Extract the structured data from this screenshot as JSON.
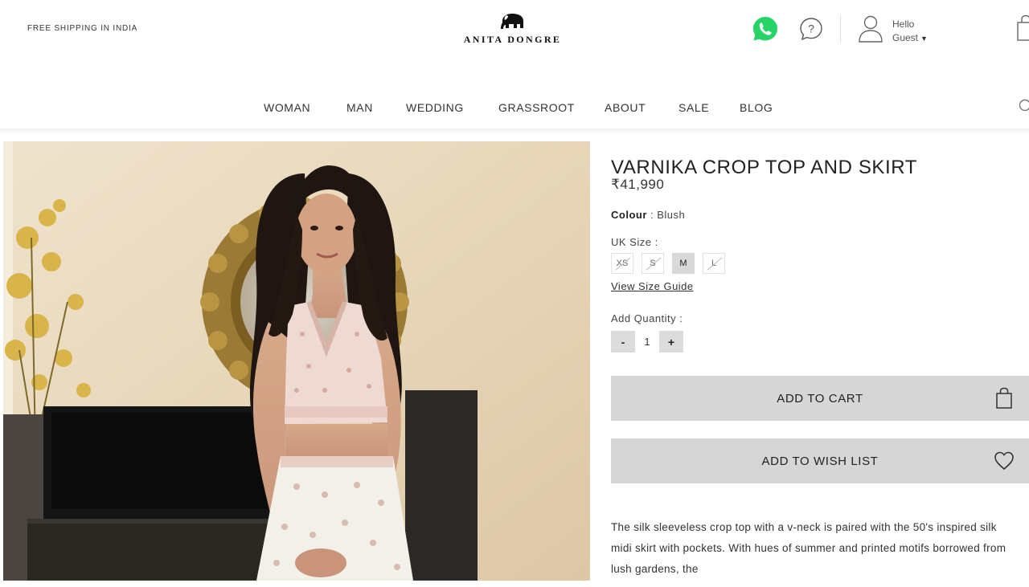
{
  "header": {
    "promo": "FREE SHIPPING IN INDIA",
    "brand_name": "ANITA DONGRE",
    "greeting_line1": "Hello",
    "greeting_line2": "Guest",
    "icons": [
      "elephant-logo-icon",
      "whatsapp-icon",
      "help-icon",
      "user-icon",
      "caret-down-icon",
      "cart-icon",
      "search-icon"
    ]
  },
  "nav": {
    "items": [
      "WOMAN",
      "MAN",
      "WEDDING",
      "GRASSROOT",
      "ABOUT",
      "SALE",
      "BLOG"
    ]
  },
  "product": {
    "title": "VARNIKA CROP TOP AND SKIRT",
    "price": "₹41,990",
    "colour_label": "Colour",
    "colour_value": ": Blush",
    "size_label": "UK Size :",
    "sizes": [
      {
        "label": "XS",
        "state": "unavailable"
      },
      {
        "label": "S",
        "state": "unavailable"
      },
      {
        "label": "M",
        "state": "selected"
      },
      {
        "label": "L",
        "state": "unavailable"
      }
    ],
    "size_guide": "View Size Guide",
    "quantity_label": "Add Quantity :",
    "quantity_minus": "-",
    "quantity_value": "1",
    "quantity_plus": "+",
    "add_to_cart": "ADD TO CART",
    "add_to_wishlist": "ADD TO WISH LIST",
    "description": "The silk sleeveless crop top with a v-neck is paired with the 50's inspired silk midi skirt with pockets. With hues of summer and printed motifs borrowed from lush gardens, the"
  },
  "colors": {
    "button_bg": "#d6d6d6",
    "selected_size_bg": "#d9d9d9",
    "whatsapp_green": "#25D366",
    "image_wall": "#e8d9c0"
  }
}
